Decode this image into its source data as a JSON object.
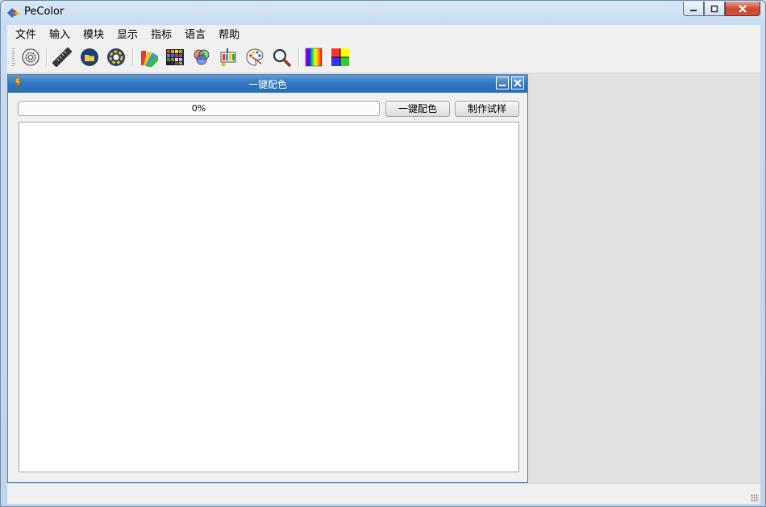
{
  "window": {
    "title": "PeColor"
  },
  "menu": [
    "文件",
    "输入",
    "模块",
    "显示",
    "指标",
    "语言",
    "帮助"
  ],
  "toolbar": {
    "buttons": [
      {
        "icon": "settings-gear-icon"
      },
      {
        "icon": "ruler-icon"
      },
      {
        "icon": "open-folder-icon"
      },
      {
        "icon": "color-ring-icon"
      },
      {
        "icon": "color-fan-deck-icon"
      },
      {
        "icon": "color-grid-palette-icon"
      },
      {
        "icon": "rgb-circles-icon"
      },
      {
        "icon": "pigment-shelf-icon"
      },
      {
        "icon": "paint-palette-icon"
      },
      {
        "icon": "magnifier-icon"
      },
      {
        "icon": "spectrum-bar-icon"
      },
      {
        "icon": "color-square-icon"
      }
    ]
  },
  "child_window": {
    "title": "一键配色",
    "progress": {
      "value": 0,
      "text": "0%"
    },
    "buttons": {
      "one_click": "一键配色",
      "make_sample": "制作试样"
    }
  },
  "colors": {
    "title_bar_active": "#2f74c0",
    "client_bg": "#f0f0f0",
    "mdi_bg": "#e1e1e1"
  }
}
